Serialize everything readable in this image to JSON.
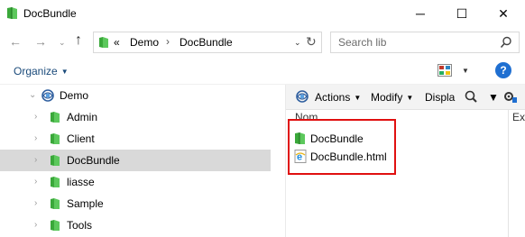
{
  "window": {
    "title": "DocBundle",
    "minimize_glyph": "─",
    "maximize_glyph": "☐",
    "close_glyph": "✕"
  },
  "nav": {
    "back_glyph": "←",
    "forward_glyph": "→",
    "recent_glyph": "⌄",
    "up_glyph": "↑"
  },
  "address": {
    "overflow": "«",
    "crumbs": [
      "Demo",
      "DocBundle"
    ],
    "separator": "›",
    "dropdown_glyph": "⌄",
    "refresh_glyph": "↻"
  },
  "search": {
    "placeholder": "Search lib"
  },
  "command_bar": {
    "organize_label": "Organize",
    "caret": "▼",
    "help_label": "?"
  },
  "tree": {
    "expander_open": "⌄",
    "expander_closed": "›",
    "root": {
      "label": "Demo",
      "icon": "library-icon"
    },
    "items": [
      {
        "label": "Admin",
        "icon": "green-folder-icon"
      },
      {
        "label": "Client",
        "icon": "green-folder-icon"
      },
      {
        "label": "DocBundle",
        "icon": "green-folder-icon"
      },
      {
        "label": "liasse",
        "icon": "green-folder-icon"
      },
      {
        "label": "Sample",
        "icon": "green-folder-icon"
      },
      {
        "label": "Tools",
        "icon": "green-folder-icon"
      }
    ]
  },
  "right_toolbar": {
    "actions": "Actions",
    "modify": "Modify",
    "display": "Displa"
  },
  "columns": {
    "name": "Nom",
    "ext": "Ex"
  },
  "files": [
    {
      "label": "DocBundle",
      "icon": "green-folder-icon"
    },
    {
      "label": "DocBundle.html",
      "icon": "ie-html-file-icon"
    }
  ],
  "colors": {
    "selection": "#d9d9d9",
    "highlight_border": "#e01010",
    "folder_green": "#2e9e2e",
    "help_blue": "#1f6fd1"
  }
}
